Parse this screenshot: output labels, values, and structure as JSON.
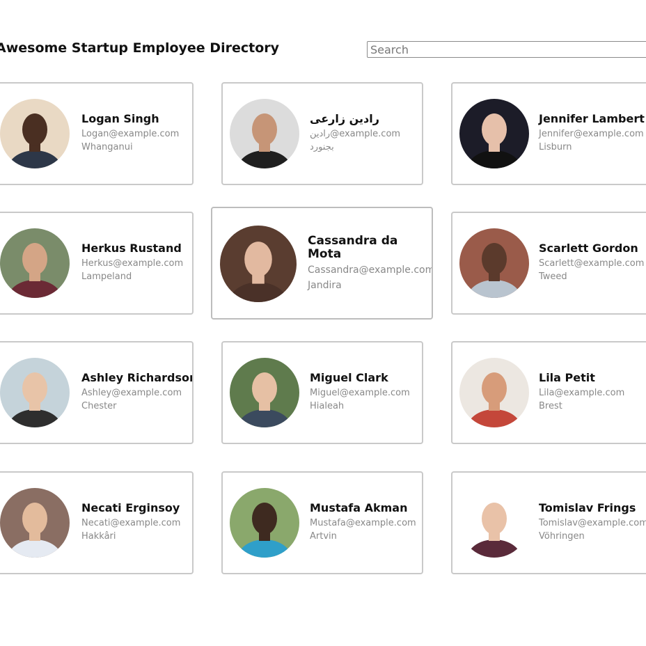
{
  "header": {
    "title": "Awesome Startup Employee Directory",
    "search_placeholder": "Search"
  },
  "employees": [
    {
      "name": "Logan Singh",
      "email": "Logan@example.com",
      "city": "Whanganui",
      "avatar_bg": "#e9d9c4",
      "skin": "#4a2f22",
      "shirt": "#2d3748"
    },
    {
      "name": "رادین زارعی",
      "email": "رادین@example.com",
      "city": "بجنورد",
      "avatar_bg": "#dcdcdc",
      "skin": "#c69577",
      "shirt": "#1f1f1f"
    },
    {
      "name": "Jennifer Lambert",
      "email": "Jennifer@example.com",
      "city": "Lisburn",
      "avatar_bg": "#1c1c28",
      "skin": "#e6c0aa",
      "shirt": "#111111"
    },
    {
      "name": "Herkus Rustand",
      "email": "Herkus@example.com",
      "city": "Lampeland",
      "avatar_bg": "#7a8c6a",
      "skin": "#d4a586",
      "shirt": "#6b2a35"
    },
    {
      "name": "Cassandra da Mota",
      "email": "Cassandra@example.com",
      "city": "Jandira",
      "avatar_bg": "#5a3d30",
      "skin": "#e2b9a0",
      "shirt": "#4a3128"
    },
    {
      "name": "Scarlett Gordon",
      "email": "Scarlett@example.com",
      "city": "Tweed",
      "avatar_bg": "#9a5b4a",
      "skin": "#5b3a2c",
      "shirt": "#b9c4cf"
    },
    {
      "name": "Ashley Richardson",
      "email": "Ashley@example.com",
      "city": "Chester",
      "avatar_bg": "#c5d3da",
      "skin": "#e8c4a8",
      "shirt": "#2e2e2e"
    },
    {
      "name": "Miguel Clark",
      "email": "Miguel@example.com",
      "city": "Hialeah",
      "avatar_bg": "#5f7b4d",
      "skin": "#e6c0a4",
      "shirt": "#3b4a5e"
    },
    {
      "name": "Lila Petit",
      "email": "Lila@example.com",
      "city": "Brest",
      "avatar_bg": "#ece7e1",
      "skin": "#d79c7a",
      "shirt": "#c4473a"
    },
    {
      "name": "Necati Erginsoy",
      "email": "Necati@example.com",
      "city": "Hakkâri",
      "avatar_bg": "#8a6e63",
      "skin": "#e3bb9c",
      "shirt": "#e5eaf2"
    },
    {
      "name": "Mustafa Akman",
      "email": "Mustafa@example.com",
      "city": "Artvin",
      "avatar_bg": "#8aa86c",
      "skin": "#3e2a20",
      "shirt": "#2f9fc9"
    },
    {
      "name": "Tomislav Frings",
      "email": "Tomislav@example.com",
      "city": "Vöhringen",
      "avatar_bg": "#ffffff",
      "skin": "#e9c2a8",
      "shirt": "#5a2a3a"
    }
  ]
}
